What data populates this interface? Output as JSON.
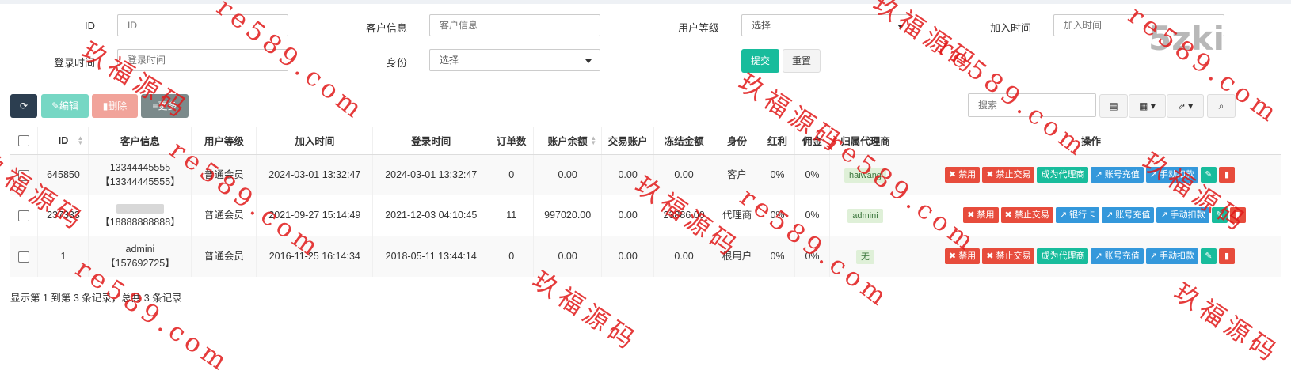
{
  "search": {
    "id_label": "ID",
    "id_placeholder": "ID",
    "customer_label": "客户信息",
    "customer_placeholder": "客户信息",
    "level_label": "用户等级",
    "level_value": "选择",
    "join_label": "加入时间",
    "join_placeholder": "加入时间",
    "login_label": "登录时间",
    "login_placeholder": "登录时间",
    "role_label": "身份",
    "role_value": "选择",
    "submit_label": "提交",
    "reset_label": "重置"
  },
  "toolbar": {
    "refresh_icon": "refresh-icon",
    "edit_label": "编辑",
    "delete_label": "删除",
    "more_label": "更多",
    "search_placeholder": "搜索"
  },
  "colors": {
    "primary": "#18bc9c",
    "danger": "#e74c3c",
    "info": "#3498db",
    "dark": "#2c3e50"
  },
  "table": {
    "headers": [
      "ID",
      "客户信息",
      "用户等级",
      "加入时间",
      "登录时间",
      "订单数",
      "账户余额",
      "交易账户",
      "冻结金额",
      "身份",
      "红利",
      "佣金",
      "归属代理商",
      "操作"
    ],
    "rows": [
      {
        "id": "645850",
        "customer_line1": "13344445555",
        "customer_line2": "【13344445555】",
        "level": "普通会员",
        "join": "2024-03-01 13:32:47",
        "login": "2024-03-01 13:32:47",
        "orders": "0",
        "balance": "0.00",
        "trade": "0.00",
        "frozen": "0.00",
        "role": "客户",
        "bonus": "0%",
        "commission": "0%",
        "agent": "haiwang",
        "actions": [
          "禁用",
          "禁止交易",
          "成为代理商",
          "账号充值",
          "手动扣款"
        ]
      },
      {
        "id": "237333",
        "customer_line1": "",
        "customer_line2": "【18888888888】",
        "level": "普通会员",
        "join": "2021-09-27 15:14:49",
        "login": "2021-12-03 04:10:45",
        "orders": "11",
        "balance": "997020.00",
        "trade": "0.00",
        "frozen": "23886.00",
        "role": "代理商",
        "bonus": "0%",
        "commission": "0%",
        "agent": "admini",
        "actions": [
          "禁用",
          "禁止交易",
          "银行卡",
          "账号充值",
          "手动扣款"
        ]
      },
      {
        "id": "1",
        "customer_line1": "admini",
        "customer_line2": "【157692725】",
        "level": "普通会员",
        "join": "2016-11-25 16:14:34",
        "login": "2018-05-11 13:44:14",
        "orders": "0",
        "balance": "0.00",
        "trade": "0.00",
        "frozen": "0.00",
        "role": "根用户",
        "bonus": "0%",
        "commission": "0%",
        "agent": "无",
        "actions": [
          "禁用",
          "禁止交易",
          "成为代理商",
          "账号充值",
          "手动扣款"
        ]
      }
    ]
  },
  "footer": {
    "summary": "显示第 1 到第 3 条记录，总共 3 条记录"
  },
  "watermark": {
    "text_cn": "玖福源码",
    "text_url": "re589.com",
    "logo": "5zki"
  }
}
